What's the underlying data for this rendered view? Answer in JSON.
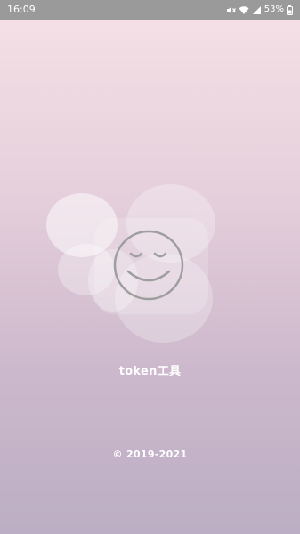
{
  "status_bar": {
    "time": "16:09",
    "battery_percent": "53%",
    "icons": [
      "mute-icon",
      "wifi-icon",
      "signal-icon",
      "battery-icon"
    ]
  },
  "splash": {
    "app_name": "token工具",
    "copyright": "© 2019-2021",
    "logo_icon": "smiley-face-icon"
  }
}
